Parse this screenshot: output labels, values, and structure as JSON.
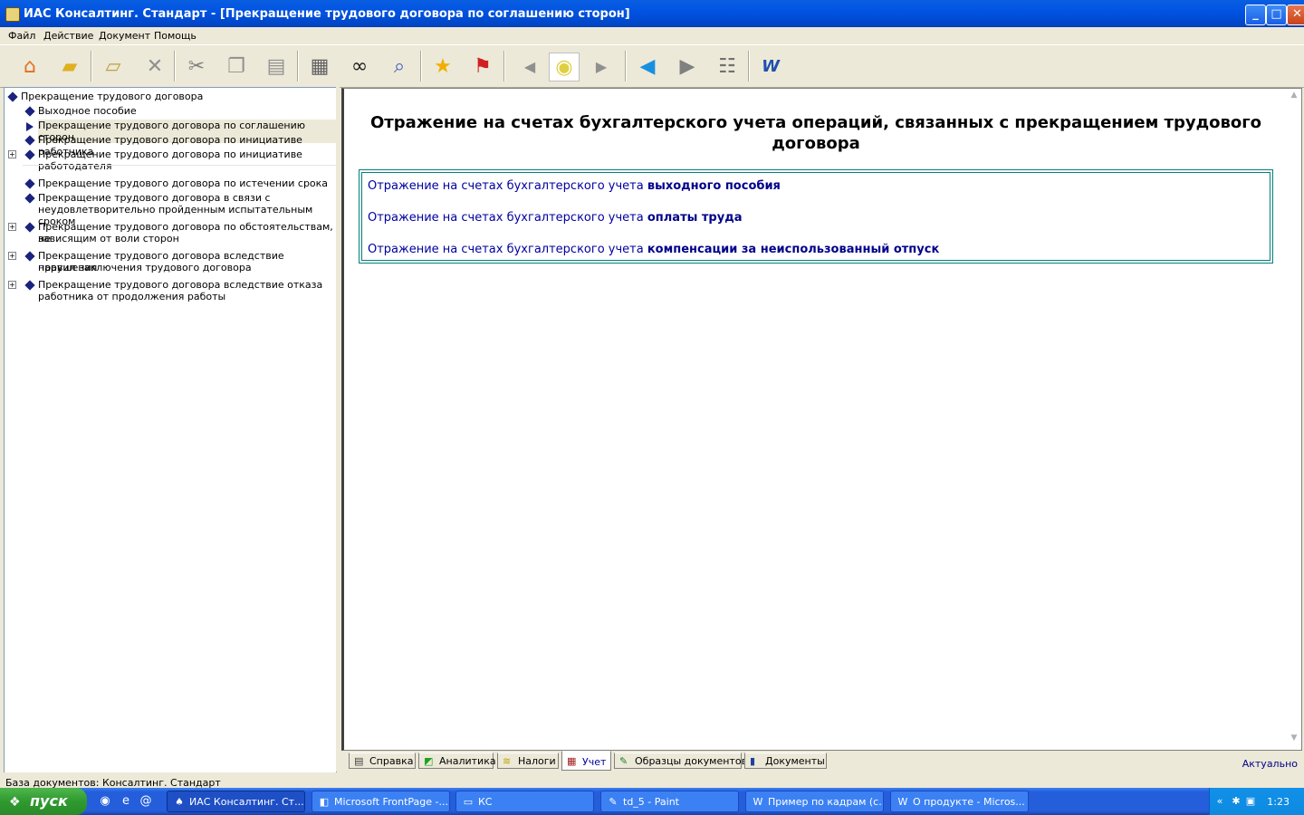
{
  "window": {
    "title": "ИАС Консалтинг. Стандарт - [Прекращение трудового договора по соглашению сторон]",
    "minimize_label": "_",
    "maximize_label": "□",
    "close_label": "✕"
  },
  "menu": [
    "Файл",
    "Действие",
    "Документ",
    "Помощь"
  ],
  "toolbar_icons": [
    "home-icon",
    "open-folder-icon",
    "folder-new-icon",
    "delete-icon",
    "cut-icon",
    "copy-icon",
    "paste-icon",
    "print-icon",
    "find-icon",
    "preview-icon",
    "favorite-star-icon",
    "bookmark-flag-icon",
    "prev-small-icon",
    "lightbulb-icon",
    "next-small-icon",
    "back-icon",
    "forward-icon",
    "tree-icon",
    "word-export-icon"
  ],
  "tree": {
    "root": "Прекращение трудового договора",
    "items": [
      {
        "label": "Выходное пособие",
        "expandable": false
      },
      {
        "label": "Прекращение трудового договора по соглашению сторон",
        "expandable": false,
        "selected": true
      },
      {
        "label": "Прекращение трудового договора по инициативе работника",
        "expandable": false
      },
      {
        "label": "Прекращение трудового договора по инициативе",
        "label2": "работодателя",
        "expandable": true
      },
      {
        "label": "Прекращение трудового договора по истечении срока",
        "expandable": false
      },
      {
        "label": "Прекращение трудового договора в связи с",
        "label2": "неудовлетворительно пройденным испытательным сроком",
        "expandable": false
      },
      {
        "label": "Прекращение трудового договора по обстоятельствам, не",
        "label2": "зависящим от воли сторон",
        "expandable": true
      },
      {
        "label": "Прекращение трудового договора вследствие нарушения",
        "label2": "правил заключения трудового договора",
        "expandable": true
      },
      {
        "label": "Прекращение трудового договора вследствие отказа",
        "label2": "работника от продолжения работы",
        "expandable": true
      }
    ]
  },
  "document": {
    "title_line1": "Отражение на счетах бухгалтерского учета операций, связанных с прекращением трудового",
    "title_line2": "договора",
    "links": [
      {
        "prefix": "Отражение на счетах бухгалтерского учета ",
        "bold": "выходного пособия"
      },
      {
        "prefix": "Отражение на счетах бухгалтерского учета ",
        "bold": "оплаты труда"
      },
      {
        "prefix": "Отражение на счетах бухгалтерского учета ",
        "bold": "компенсации за неиспользованный отпуск"
      }
    ]
  },
  "tabs": [
    {
      "label": "Справка"
    },
    {
      "label": "Аналитика"
    },
    {
      "label": "Налоги"
    },
    {
      "label": "Учет",
      "active": true
    },
    {
      "label": "Образцы документов"
    },
    {
      "label": "Документы"
    }
  ],
  "actual_label": "Актуально",
  "status": "База документов: Консалтинг. Стандарт",
  "taskbar": {
    "start_label": "пуск",
    "tasks": [
      {
        "label": "ИАС Консалтинг. Ст...",
        "active": true
      },
      {
        "label": "Microsoft FrontPage -..."
      },
      {
        "label": "КС"
      },
      {
        "label": "td_5 - Paint"
      },
      {
        "label": "Пример по кадрам (с..."
      },
      {
        "label": "О продукте - Micros..."
      }
    ],
    "clock": "1:23"
  }
}
